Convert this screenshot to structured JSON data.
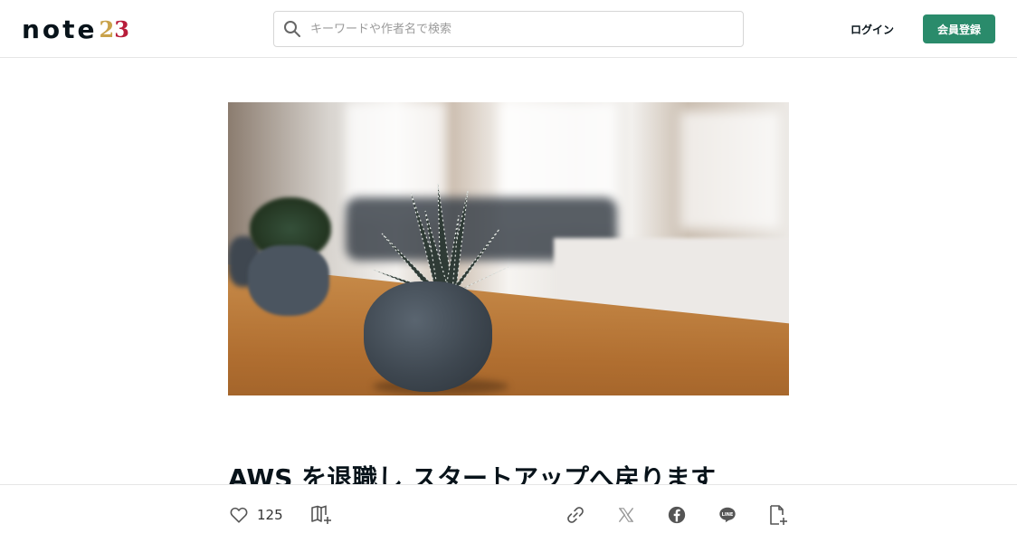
{
  "header": {
    "logo_text": "note",
    "logo_year_1": "2",
    "logo_year_2": "3",
    "search_placeholder": "キーワードや作者名で検索",
    "login_label": "ログイン",
    "signup_label": "会員登録",
    "accent_color": "#2a8b6b"
  },
  "article": {
    "title": "AWS を退職し スタートアップへ戻ります",
    "hero_image": "plant-pot-on-wooden-table"
  },
  "actions": {
    "like_icon": "heart-icon",
    "like_count": "125",
    "magazine_icon": "magazine-add-icon",
    "share_icons": [
      "link-icon",
      "x-icon",
      "facebook-icon",
      "line-icon",
      "embed-icon"
    ]
  }
}
